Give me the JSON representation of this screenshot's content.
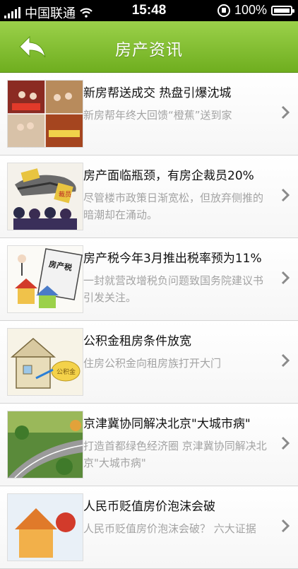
{
  "status_bar": {
    "carrier": "中国联通",
    "time": "15:48",
    "battery": "100%"
  },
  "nav": {
    "title": "房产资讯",
    "back_icon": "back-arrow-icon"
  },
  "colors": {
    "nav_top": "#9bd14a",
    "nav_bottom": "#6fae1f",
    "summary_text": "#a3a3a3",
    "chevron": "#8a8a8a"
  },
  "news": [
    {
      "title": "新房帮送成交 热盘引爆沈城",
      "summary": "新房帮年终大回馈“橙蕉”送到家"
    },
    {
      "title": "房产面临瓶颈，有房企裁员20%",
      "summary": "尽管楼市政策日渐宽松，但放弃侧推的暗潮却在涌动。"
    },
    {
      "title": "房产税今年3月推出税率预为11%",
      "summary": "一封就营改增税负问题致国务院建议书引发关注。"
    },
    {
      "title": "公积金租房条件放宽",
      "summary": "住房公积金向租房族打开大门"
    },
    {
      "title": "京津冀协同解决北京\"大城市病\"",
      "summary": "打造首都绿色经济圈 京津冀协同解决北京\"大城市病\""
    },
    {
      "title": "人民币贬值房价泡沫会破",
      "summary": "人民币贬值房价泡沫会破？ 六大证据"
    }
  ],
  "thumb_labels": {
    "layoff": "裁员",
    "property_tax": "房产税",
    "fund": "公积金"
  }
}
